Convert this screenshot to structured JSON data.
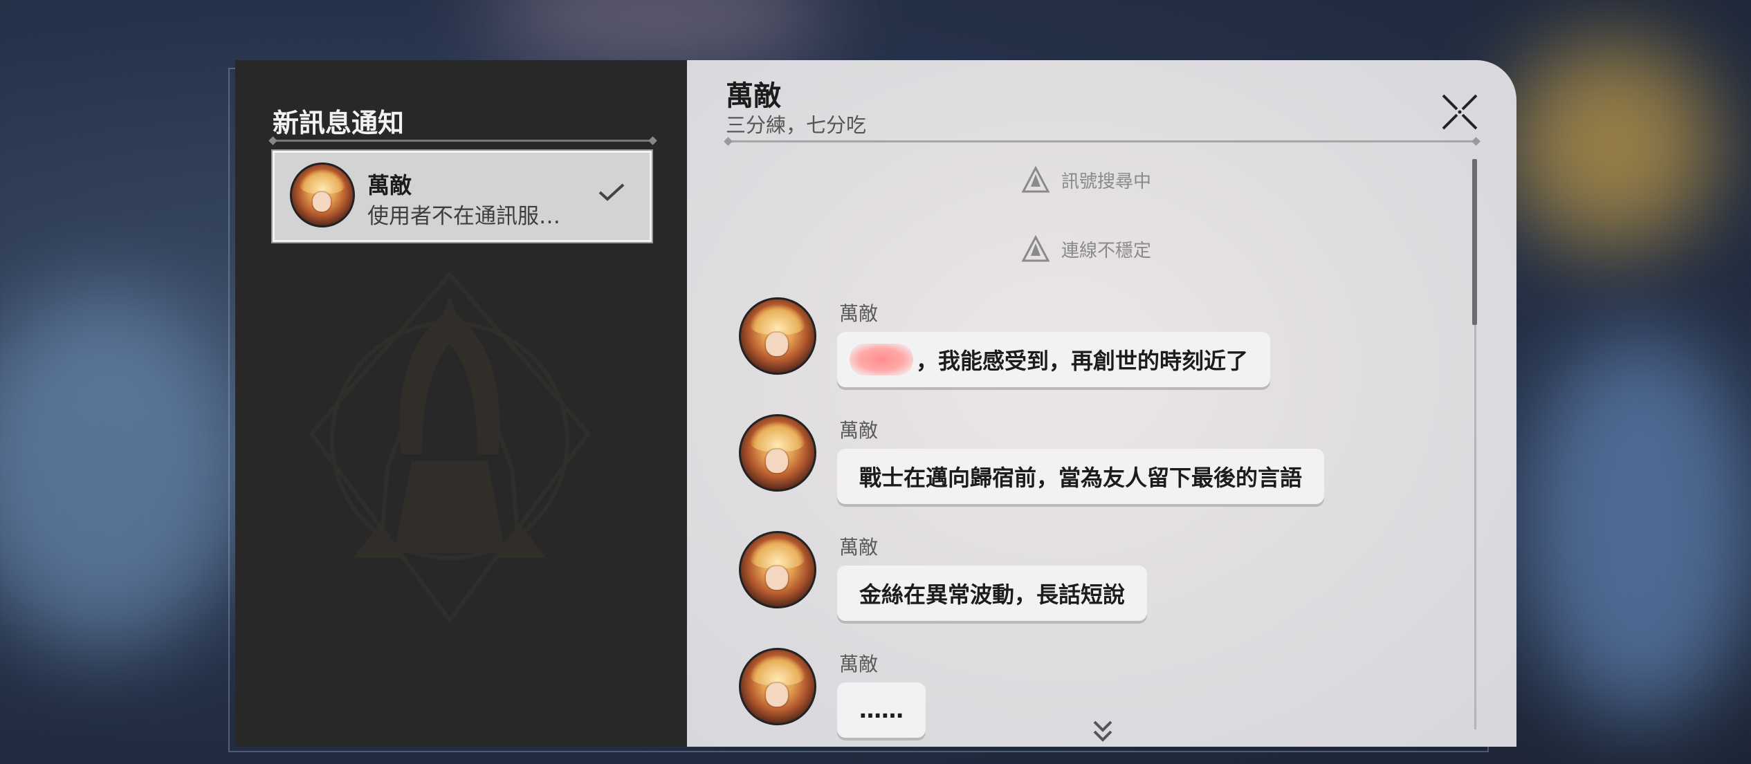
{
  "notifications": {
    "title": "新訊息通知",
    "items": [
      {
        "name": "萬敵",
        "preview": "使用者不在通訊服…",
        "status": "read"
      }
    ]
  },
  "chat": {
    "contact_name": "萬敵",
    "contact_signature": "三分練，七分吃",
    "system_messages": [
      "訊號搜尋中",
      "連線不穩定"
    ],
    "messages": [
      {
        "sender": "萬敵",
        "text": "，我能感受到，再創世的時刻近了"
      },
      {
        "sender": "萬敵",
        "text": "戰士在邁向歸宿前，當為友人留下最後的言語"
      },
      {
        "sender": "萬敵",
        "text": "金絲在異常波動，長話短說"
      },
      {
        "sender": "萬敵",
        "text": "……"
      }
    ]
  },
  "icons": {
    "close": "close-icon",
    "check": "check-icon",
    "signal": "signal-warning-icon",
    "scroll_more": "double-chevron-down-icon",
    "emblem": "faction-emblem-icon"
  },
  "colors": {
    "left_panel": "#282828",
    "right_panel": "#dedcdf",
    "bubble": "#f2f2f2",
    "text_dark": "#1c1c1c"
  }
}
